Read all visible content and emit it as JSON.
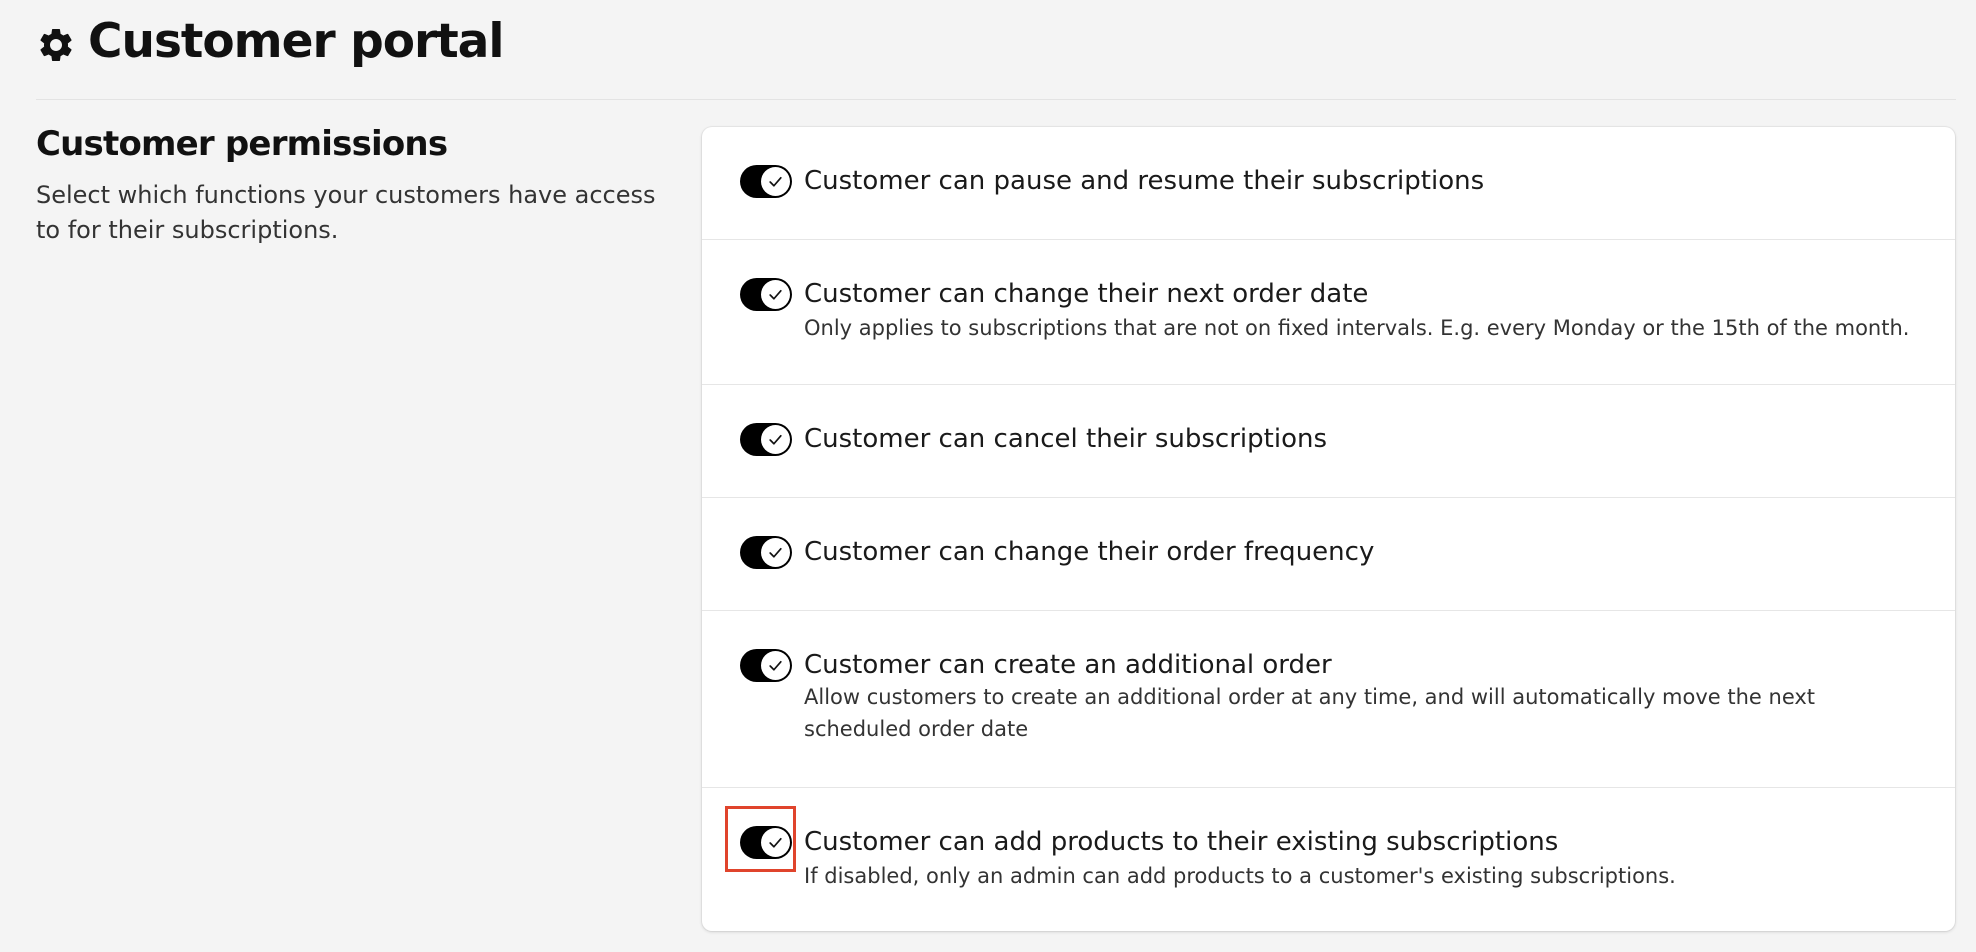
{
  "page": {
    "title": "Customer portal",
    "icon": "gear-icon"
  },
  "section": {
    "title": "Customer permissions",
    "description": "Select which functions your customers have access to for their subscriptions."
  },
  "permissions": [
    {
      "label": "Customer can pause and resume their subscriptions",
      "description": "",
      "enabled": true
    },
    {
      "label": "Customer can change their next order date",
      "description": "Only applies to subscriptions that are not on fixed intervals. E.g. every Monday or the 15th of the month.",
      "enabled": true
    },
    {
      "label": "Customer can cancel their subscriptions",
      "description": "",
      "enabled": true
    },
    {
      "label": "Customer can change their order frequency",
      "description": "",
      "enabled": true
    },
    {
      "label": "Customer can create an additional order",
      "description": "Allow customers to create an additional order at any time, and will automatically move the next scheduled order date",
      "enabled": true
    },
    {
      "label": "Customer can add products to their existing subscriptions",
      "description": "If disabled, only an admin can add products to a customer's existing subscriptions.",
      "enabled": true
    }
  ],
  "colors": {
    "toggle_on": "#000000",
    "highlight": "#e0442c",
    "background": "#f4f4f4"
  }
}
